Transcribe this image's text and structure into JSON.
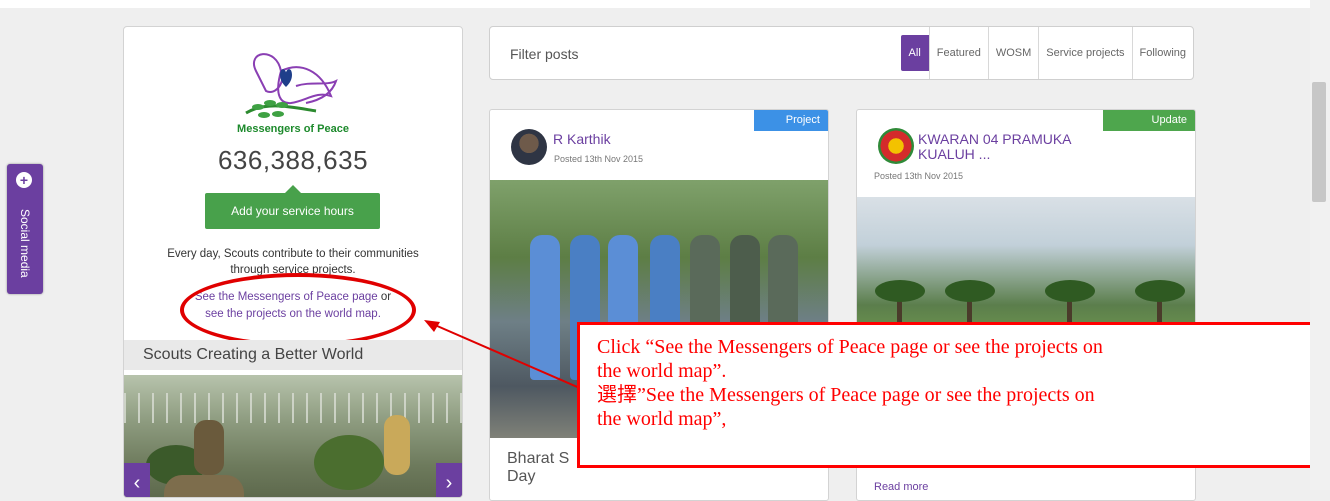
{
  "social_tab": {
    "label": "Social media",
    "icon": "plus-circle-icon"
  },
  "left_card": {
    "logo_caption": "Messengers of Peace",
    "counter": "636,388,635",
    "add_button": "Add your service hours",
    "description": "Every day, Scouts contribute to their communities through service projects.",
    "link_mop": "See the Messengers of Peace page",
    "link_or": " or",
    "link_map": "see the projects on the world map.",
    "carousel_title": "Scouts Creating a Better World",
    "carousel_prev": "‹",
    "carousel_next": "›"
  },
  "filter_bar": {
    "placeholder": "Filter posts",
    "tabs": [
      "All",
      "Featured",
      "WOSM",
      "Service projects",
      "Following"
    ],
    "active_tab": "All"
  },
  "posts": [
    {
      "badge": "Project",
      "author": "R Karthik",
      "date": "Posted 13th Nov 2015",
      "title": "Bharat S",
      "title_line2": "Day",
      "badge_color": "#3c91e6"
    },
    {
      "badge": "Update",
      "author_line1": "KWARAN 04 PRAMUKA",
      "author_line2": "KUALUH ...",
      "date": "Posted 13th Nov 2015",
      "read_more": "Read more",
      "badge_color": "#4ea64d"
    }
  ],
  "callout": {
    "line1": "Click “See the Messengers of Peace page or see the projects on",
    "line2": "the world map”.",
    "line3": "選擇”See the Messengers of Peace page or see the projects on",
    "line4": "the world map”,"
  },
  "colors": {
    "accent": "#6b3fa0",
    "green": "#48a14b",
    "annotation": "#ff0000"
  }
}
